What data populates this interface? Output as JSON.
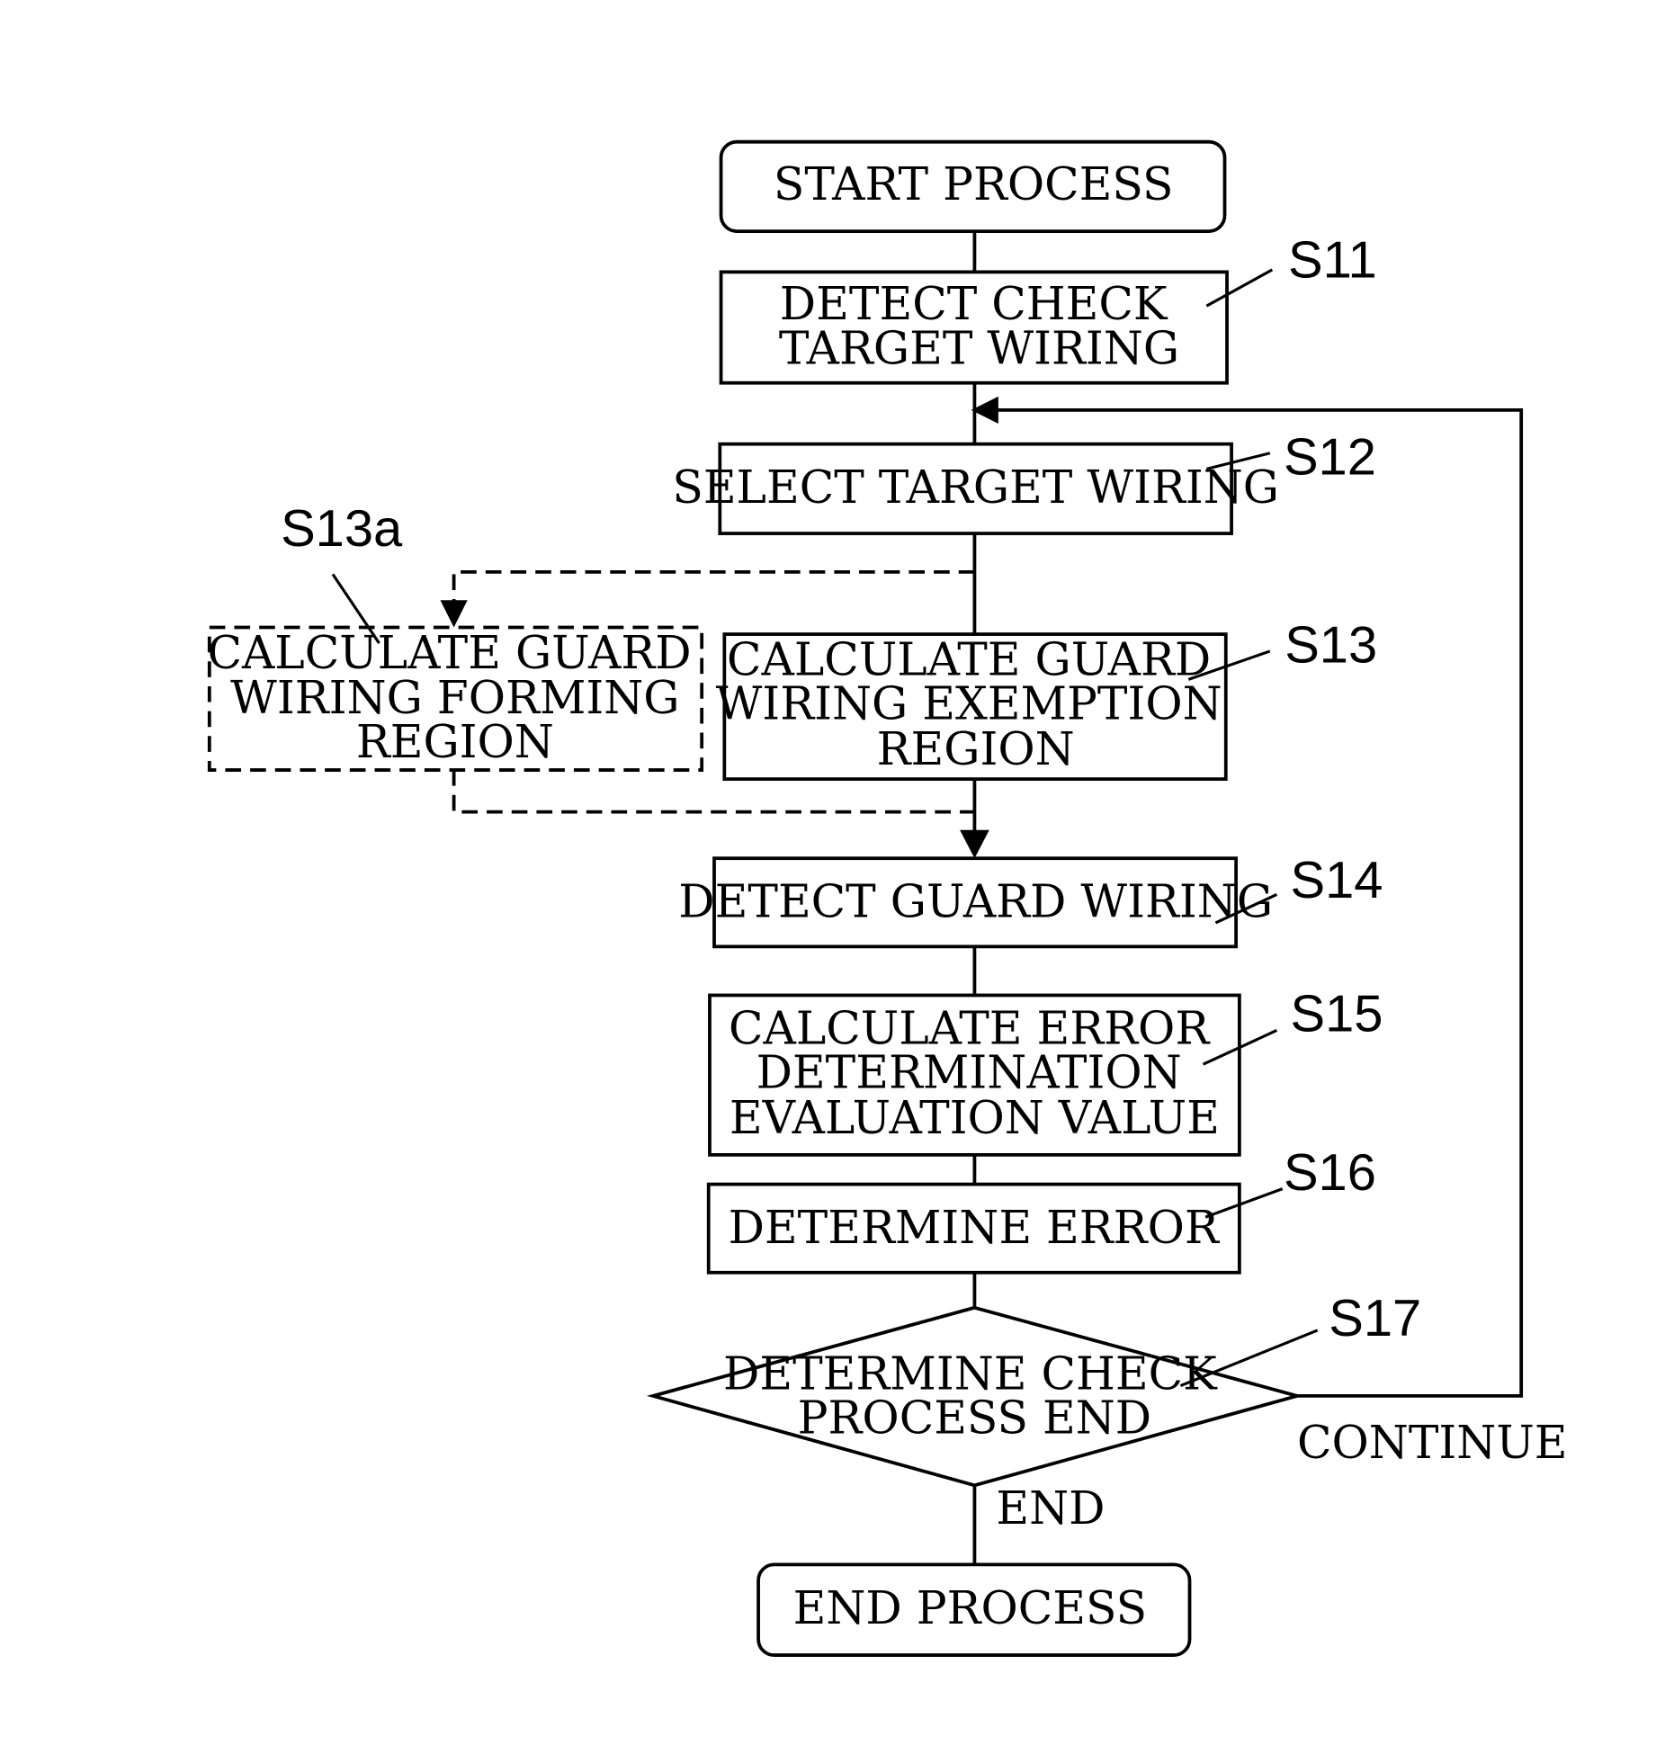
{
  "nodes": {
    "start": {
      "text": [
        "START PROCESS"
      ]
    },
    "s11": {
      "step": "S11",
      "text": [
        "DETECT CHECK",
        "TARGET WIRING"
      ]
    },
    "s12": {
      "step": "S12",
      "text": [
        "SELECT TARGET WIRING"
      ]
    },
    "s13a": {
      "step": "S13a",
      "text": [
        "CALCULATE GUARD",
        "WIRING FORMING",
        "REGION"
      ],
      "optional": true
    },
    "s13": {
      "step": "S13",
      "text": [
        "CALCULATE GUARD",
        "WIRING EXEMPTION",
        "REGION"
      ]
    },
    "s14": {
      "step": "S14",
      "text": [
        "DETECT GUARD WIRING"
      ]
    },
    "s15": {
      "step": "S15",
      "text": [
        "CALCULATE ERROR",
        "DETERMINATION",
        "EVALUATION VALUE"
      ]
    },
    "s16": {
      "step": "S16",
      "text": [
        "DETERMINE ERROR"
      ]
    },
    "s17": {
      "step": "S17",
      "text": [
        "DETERMINE CHECK",
        "PROCESS END"
      ]
    },
    "end": {
      "text": [
        "END PROCESS"
      ]
    }
  },
  "branches": {
    "continue": "CONTINUE",
    "end": "END"
  }
}
